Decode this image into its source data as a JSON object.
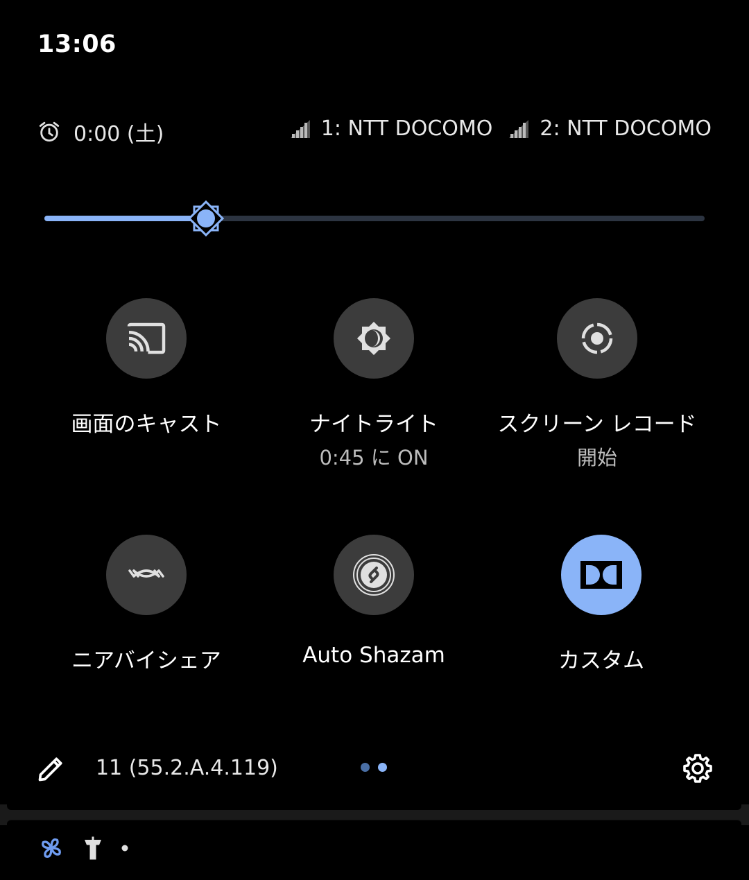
{
  "status": {
    "time": "13:06"
  },
  "header": {
    "alarm_text": "0:00 (土)",
    "carriers": [
      {
        "label": "1: NTT DOCOMO"
      },
      {
        "label": "2: NTT DOCOMO"
      }
    ]
  },
  "brightness": {
    "level_fraction": 0.245,
    "accent": "#8ab4f8"
  },
  "tiles": [
    {
      "label": "画面のキャスト",
      "sub": "",
      "icon": "cast-icon",
      "active": false
    },
    {
      "label": "ナイトライト",
      "sub": "0:45 に ON",
      "icon": "night-light-icon",
      "active": false
    },
    {
      "label": "スクリーン レコード",
      "sub": "開始",
      "icon": "screen-record-icon",
      "active": false
    },
    {
      "label": "ニアバイシェア",
      "sub": "",
      "icon": "nearby-share-icon",
      "active": false
    },
    {
      "label": "Auto Shazam",
      "sub": "",
      "icon": "shazam-icon",
      "active": false
    },
    {
      "label": "カスタム",
      "sub": "",
      "icon": "dolby-icon",
      "active": true
    }
  ],
  "footer": {
    "build": "11 (55.2.A.4.119)",
    "page_dots": [
      {
        "active": false,
        "color": "#4a6fa5"
      },
      {
        "active": true,
        "color": "#8ab4f8"
      }
    ]
  },
  "notification_icons": [
    "pinwheel-icon",
    "airport-icon",
    "more-dot-icon"
  ]
}
